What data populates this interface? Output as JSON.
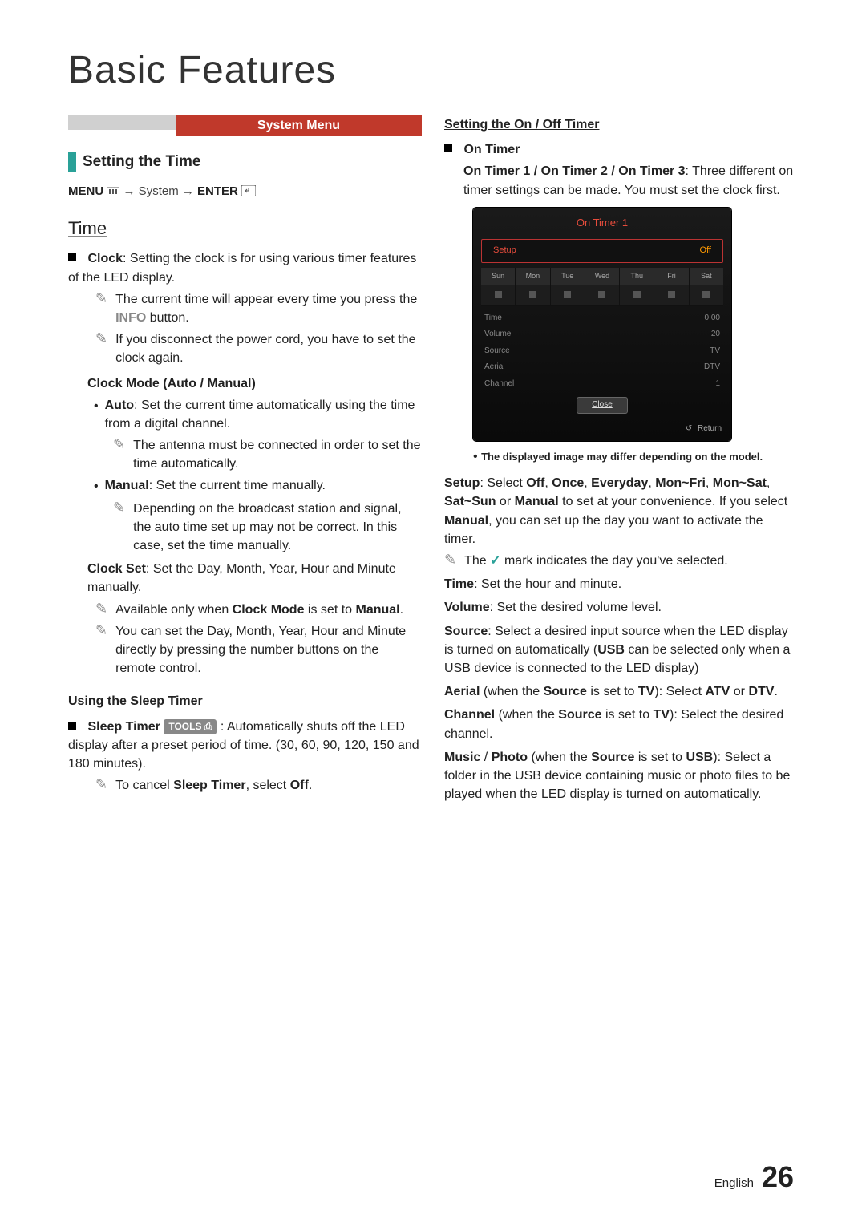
{
  "page": {
    "title": "Basic Features",
    "section_band": "System Menu",
    "left_subheading": "Setting the Time",
    "menu_path_pre": "MENU",
    "menu_path_mid": " → System → ",
    "menu_path_end": "ENTER",
    "time_heading": "Time",
    "clock_bold": "Clock",
    "clock_text": ": Setting the clock is for using various timer features of the LED display.",
    "note1a": "The current time will appear every time you press the ",
    "info_label": "INFO",
    "note1b": " button.",
    "note2": "If you disconnect the power cord, you have to set the clock again.",
    "clock_mode_heading": "Clock Mode (Auto / Manual)",
    "auto_bold": "Auto",
    "auto_text": ": Set the current time automatically using the time from a digital channel.",
    "auto_note": "The antenna must be connected in order to set the time automatically.",
    "manual_bold": "Manual",
    "manual_text": ": Set the current time manually.",
    "manual_note": "Depending on the broadcast station and signal, the auto time set up may not be correct. In this case, set the time manually.",
    "clock_set_bold": "Clock Set",
    "clock_set_text": ": Set the Day, Month, Year, Hour and Minute manually.",
    "clock_set_note1a": "Available only when ",
    "clock_set_note1b": "Clock Mode",
    "clock_set_note1c": " is set to ",
    "clock_set_note1d": "Manual",
    "clock_set_note1e": ".",
    "clock_set_note2": "You can set the Day, Month, Year, Hour and Minute directly by pressing the number buttons on the remote control.",
    "sleep_heading": "Using the Sleep Timer",
    "sleep_bold": "Sleep Timer",
    "tools_label": "TOOLS",
    "sleep_text": ": Automatically shuts off the LED display after a preset period of time. (30, 60, 90, 120, 150 and 180 minutes).",
    "sleep_note_a": "To cancel ",
    "sleep_note_b": "Sleep Timer",
    "sleep_note_c": ", select ",
    "sleep_note_d": "Off",
    "sleep_note_e": ".",
    "onoff_heading": "Setting the On / Off Timer",
    "on_timer_label": "On Timer",
    "on_timer_line_b1": "On Timer 1 / On Timer 2 / On Timer 3",
    "on_timer_line_txt": ": Three different on timer settings can be made. You must set the clock first.",
    "disclaimer": "The displayed image may differ depending on the model.",
    "setup_b": "Setup",
    "setup_txt1": ": Select ",
    "setup_opt_off": "Off",
    "setup_opt_once": "Once",
    "setup_opt_every": "Everyday",
    "setup_opt_monfri": "Mon~Fri",
    "setup_opt_monsat": "Mon~Sat",
    "setup_opt_satsun": "Sat~Sun",
    "setup_opt_manual": "Manual",
    "setup_txt2": " to set at your convenience. If you select ",
    "setup_txt3": ", you can set up the day you want to activate the timer.",
    "check_note_a": "The ",
    "check_note_b": " mark indicates the day you've selected.",
    "time_b": "Time",
    "time_txt": ": Set the hour and minute.",
    "vol_b": "Volume",
    "vol_txt": ": Set the desired volume level.",
    "source_b": "Source",
    "source_txt1": ": Select a desired input source when the LED display is turned on automatically (",
    "source_usb": "USB",
    "source_txt2": " can be selected only when a USB device is connected to the LED display)",
    "aerial_b": "Aerial",
    "aerial_txt1": " (when the ",
    "aerial_src": "Source",
    "aerial_txt2": " is set to ",
    "aerial_tv": "TV",
    "aerial_txt3": "): Select ",
    "aerial_atv": "ATV",
    "aerial_or": " or ",
    "aerial_dtv": "DTV",
    "aerial_end": ".",
    "channel_b": "Channel",
    "channel_txt1": " (when the ",
    "channel_txt2": " is set to ",
    "channel_txt3": "): Select the desired channel.",
    "music_b": "Music",
    "photo_b": "Photo",
    "music_txt1": " (when the ",
    "music_txt2": " is set to ",
    "music_txt3": "): Select a folder in the USB device containing music or photo files to be played when the LED display is turned on automatically.",
    "footer_lang": "English",
    "footer_num": "26"
  },
  "osd": {
    "title": "On Timer 1",
    "setup_label": "Setup",
    "setup_value": "Off",
    "days": [
      "Sun",
      "Mon",
      "Tue",
      "Wed",
      "Thu",
      "Fri",
      "Sat"
    ],
    "rows": [
      {
        "label": "Time",
        "value": "0:00"
      },
      {
        "label": "Volume",
        "value": "20"
      },
      {
        "label": "Source",
        "value": "TV"
      },
      {
        "label": "Aerial",
        "value": "DTV"
      },
      {
        "label": "Channel",
        "value": "1"
      }
    ],
    "close": "Close",
    "return": "Return"
  }
}
